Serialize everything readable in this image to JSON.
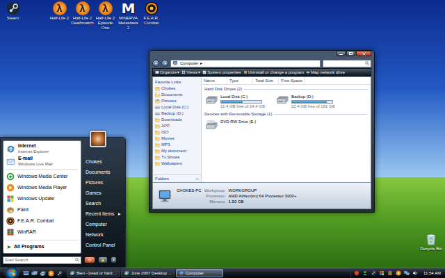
{
  "desktop_icons": [
    {
      "label": "Steam",
      "kind": "steam"
    },
    {
      "label": "Half-Life 2",
      "kind": "lambda",
      "glyph": "λ"
    },
    {
      "label": "Half-Life 2 Deathmatch",
      "kind": "lambda",
      "glyph": "λ"
    },
    {
      "label": "Half-Life 2 Episode One",
      "kind": "lambda",
      "glyph": "λ"
    },
    {
      "label": "MINERVA Metastasis 2",
      "kind": "minerva",
      "glyph": "M"
    },
    {
      "label": "F.E.A.R. Combat",
      "kind": "fear"
    }
  ],
  "recycle_bin": {
    "label": "Recycle Bin"
  },
  "explorer": {
    "address": {
      "location": "Computer",
      "separator": "▸"
    },
    "toolbar": [
      {
        "label": "Organize",
        "dropdown": "▾",
        "kind": "organize"
      },
      {
        "label": "Views",
        "dropdown": "▾",
        "kind": "views"
      },
      {
        "label": "System properties",
        "kind": "properties"
      },
      {
        "label": "Uninstall or change a program",
        "kind": "uninstall"
      },
      {
        "label": "Map network drive",
        "kind": "map"
      }
    ],
    "favorites": {
      "title": "Favorite Links",
      "items": [
        {
          "label": "Chokes",
          "kind": "user"
        },
        {
          "label": "Documents",
          "kind": "documents"
        },
        {
          "label": "Pictures",
          "kind": "pictures"
        },
        {
          "label": "Local Disk (C:)",
          "kind": "drive"
        },
        {
          "label": "Backup (D:)",
          "kind": "drive"
        },
        {
          "label": "Downloads",
          "kind": "folder"
        },
        {
          "label": "APP",
          "kind": "folder"
        },
        {
          "label": "ISO",
          "kind": "folder"
        },
        {
          "label": "Movies",
          "kind": "folder"
        },
        {
          "label": "MP3",
          "kind": "folder"
        },
        {
          "label": "My document",
          "kind": "folder"
        },
        {
          "label": "Tv Shows",
          "kind": "folder"
        },
        {
          "label": "Wallpapers",
          "kind": "folder"
        }
      ]
    },
    "folders": {
      "label": "Folders"
    },
    "columns": [
      "Name",
      "Type",
      "Total Size",
      "Free Space"
    ],
    "groups": [
      {
        "title": "Hard Disk Drives (2)",
        "items": [
          {
            "name": "Local Disk (C:)",
            "kind": "disk",
            "level": 0.53,
            "detail": "11.4 GB free of 24.4 GB"
          },
          {
            "name": "Backup (D:)",
            "kind": "disk",
            "level": 0.86,
            "detail": "22.4 GB free of 161 GB"
          }
        ]
      },
      {
        "title": "Devices with Removable Storage (1)",
        "items": [
          {
            "name": "DVD RW Drive (E:)",
            "kind": "dvd"
          }
        ]
      }
    ],
    "details": {
      "computer": "CHOKES-PC",
      "fields": [
        {
          "label": "Workgroup:",
          "value": "WORKGROUP"
        },
        {
          "label": "Processor:",
          "value": "AMD Athlon(tm) 64 Processor 3000+"
        },
        {
          "label": "Memory:",
          "value": "1.50 GB"
        }
      ]
    }
  },
  "start_menu": {
    "pinned": [
      {
        "title": "Internet",
        "subtitle": "Internet Explorer",
        "kind": "ie"
      },
      {
        "title": "E-mail",
        "subtitle": "Windows Live Mail",
        "kind": "mail"
      }
    ],
    "recent": [
      {
        "label": "Windows Media Center",
        "kind": "media-center"
      },
      {
        "label": "Windows Media Player",
        "kind": "media-player"
      },
      {
        "label": "Windows Update",
        "kind": "update"
      },
      {
        "label": "Paint",
        "kind": "paint"
      },
      {
        "label": "F.E.A.R. Combat",
        "kind": "fear"
      },
      {
        "label": "WinRAR",
        "kind": "winrar"
      }
    ],
    "all_programs": {
      "label": "All Programs",
      "arrow": "▶"
    },
    "search": {
      "placeholder": "Start Search"
    },
    "places": [
      {
        "label": "Chokes"
      },
      {
        "label": "Documents"
      },
      {
        "label": "Pictures"
      },
      {
        "label": "Games"
      },
      {
        "label": "Search"
      },
      {
        "label": "Recent Items",
        "arrow": "▸"
      },
      {
        "label": "Computer"
      },
      {
        "label": "Network"
      },
      {
        "label": "Control Panel"
      }
    ]
  },
  "taskbar": {
    "quick_launch": [
      {
        "kind": "desktop"
      },
      {
        "kind": "switch"
      },
      {
        "kind": "ie"
      },
      {
        "kind": "media-player"
      },
      {
        "kind": "steam"
      }
    ],
    "tasks": [
      {
        "label": "Bien - [read or hard ...",
        "kind": "ie",
        "selected": false
      },
      {
        "label": "June 2007 Desktop ...",
        "kind": "ie",
        "selected": false
      },
      {
        "label": "Computer",
        "kind": "computer",
        "selected": true
      }
    ],
    "tray": [
      {
        "kind": "shield"
      },
      {
        "kind": "chat"
      },
      {
        "kind": "steam"
      },
      {
        "kind": "update"
      },
      {
        "kind": "winrar"
      },
      {
        "kind": "media-player"
      },
      {
        "kind": "network"
      },
      {
        "kind": "volume"
      }
    ],
    "clock": "11:54 AM"
  }
}
